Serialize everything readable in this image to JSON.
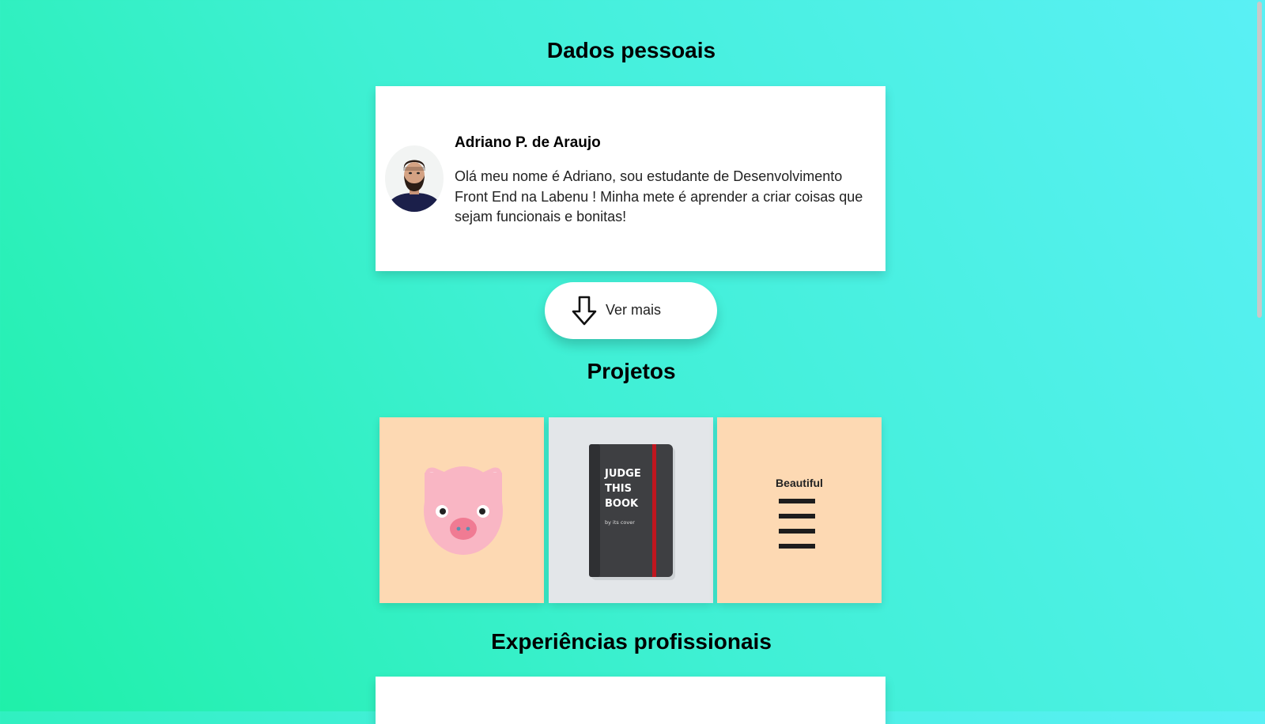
{
  "sections": {
    "personal_title": "Dados pessoais",
    "projects_title": "Projetos",
    "experience_title": "Experiências profissionais"
  },
  "profile": {
    "name": "Adriano P. de Araujo",
    "bio": "Olá meu nome é Adriano, sou estudante de Desenvolvimento Front End na Labenu ! Minha mete é aprender a criar coisas que sejam funcionais e bonitas!",
    "avatar_icon": "user-photo"
  },
  "more_button": {
    "label": "Ver mais",
    "icon": "arrow-down-icon"
  },
  "projects": [
    {
      "icon": "pig-illustration",
      "bg": "#fdd9b3"
    },
    {
      "icon": "book-illustration",
      "bg": "#e3e6e9",
      "cover_lines": [
        "JUDGE",
        "THIS",
        "BOOK"
      ],
      "cover_sub": "by its cover"
    },
    {
      "icon": "hamburger-illustration",
      "bg": "#fdd9b3",
      "label": "Beautiful"
    }
  ],
  "colors": {
    "gradient_start": "#1ff0a9",
    "gradient_end": "#5af0f5",
    "card": "#ffffff"
  }
}
